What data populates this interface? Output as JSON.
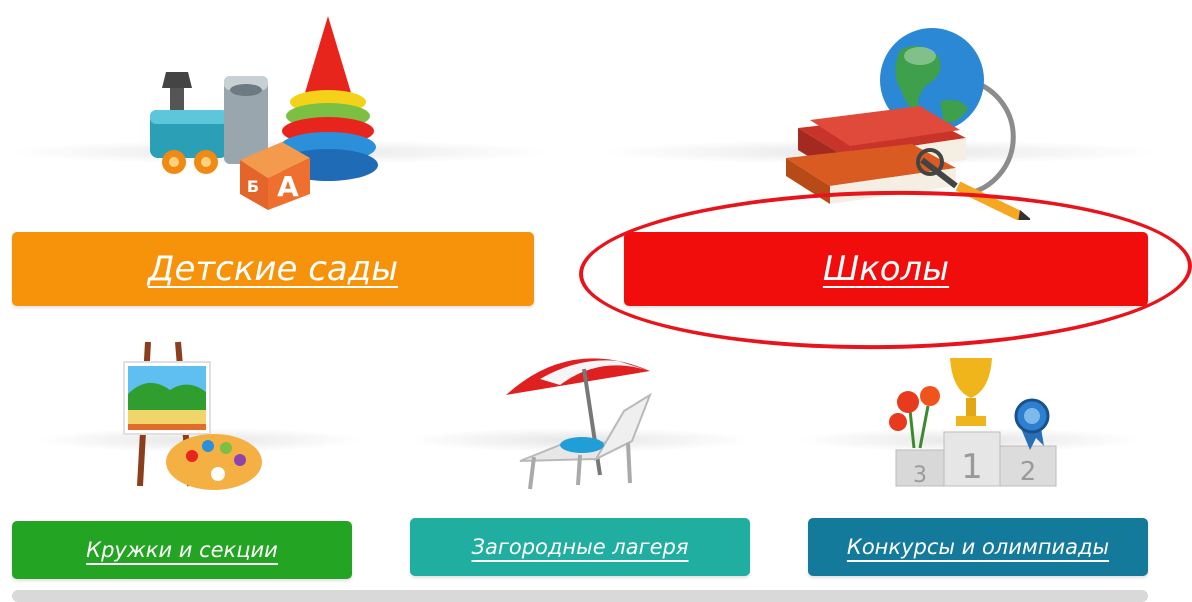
{
  "tiles": {
    "kindergartens": {
      "label": "Детские сады",
      "color": "#f7930a"
    },
    "schools": {
      "label": "Школы",
      "color": "#f20d0d"
    },
    "clubs": {
      "label": "Кружки и секции",
      "color": "#23a523"
    },
    "camps": {
      "label": "Загородные лагеря",
      "color": "#1faea0"
    },
    "contests": {
      "label": "Конкурсы и олимпиады",
      "color": "#137a9c"
    }
  },
  "illustrations": {
    "kindergartens": "toys-icon",
    "schools": "books-globe-icon",
    "clubs": "easel-palette-icon",
    "camps": "beach-lounger-icon",
    "contests": "podium-trophy-icon"
  },
  "podium_numbers": [
    "3",
    "1",
    "2"
  ],
  "abc_block_letters": [
    "А",
    "Б"
  ],
  "highlight": {
    "target": "schools",
    "color": "#e8141c"
  }
}
